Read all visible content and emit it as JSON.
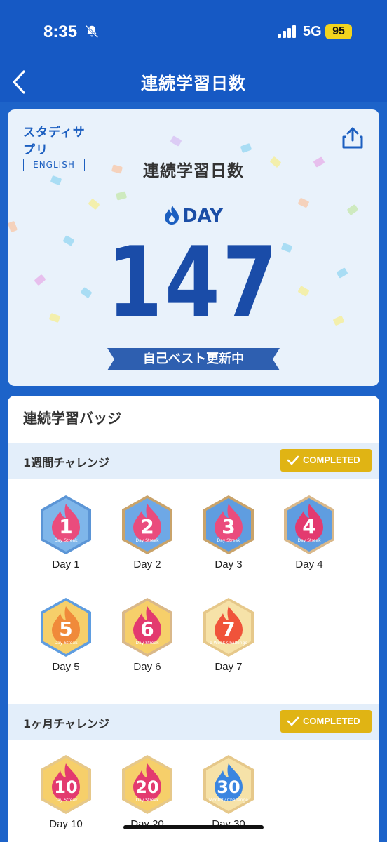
{
  "status_bar": {
    "time": "8:35",
    "network": "5G",
    "battery": "95"
  },
  "nav": {
    "title": "連続学習日数"
  },
  "hero": {
    "logo_jp": "スタディサプリ",
    "logo_en": "ENGLISH",
    "title": "連続学習日数",
    "day_label": "DAY",
    "day_count": "147",
    "ribbon": "自己ベスト更新中"
  },
  "badges": {
    "title": "連続学習バッジ",
    "sections": [
      {
        "label": "1週間チャレンジ",
        "status": "COMPLETED",
        "items": [
          {
            "label": "Day 1",
            "number": "1",
            "caption": "Day Streak"
          },
          {
            "label": "Day 2",
            "number": "2",
            "caption": "Day Streak"
          },
          {
            "label": "Day 3",
            "number": "3",
            "caption": "Day Streak"
          },
          {
            "label": "Day 4",
            "number": "4",
            "caption": "Day Streak"
          },
          {
            "label": "Day 5",
            "number": "5",
            "caption": "Day Streak"
          },
          {
            "label": "Day 6",
            "number": "6",
            "caption": "Day Streak"
          },
          {
            "label": "Day 7",
            "number": "7",
            "caption": "1 Week Challenge"
          }
        ]
      },
      {
        "label": "1ヶ月チャレンジ",
        "status": "COMPLETED",
        "items": [
          {
            "label": "Day 10",
            "number": "10",
            "caption": "Day Streak"
          },
          {
            "label": "Day 20",
            "number": "20",
            "caption": "Day Streak"
          },
          {
            "label": "Day 30",
            "number": "30",
            "caption": "Monthly Challenge"
          }
        ]
      }
    ]
  },
  "colors": {
    "primary": "#1659c4",
    "accent": "#e0b414",
    "day_number": "#1a4ca8"
  }
}
